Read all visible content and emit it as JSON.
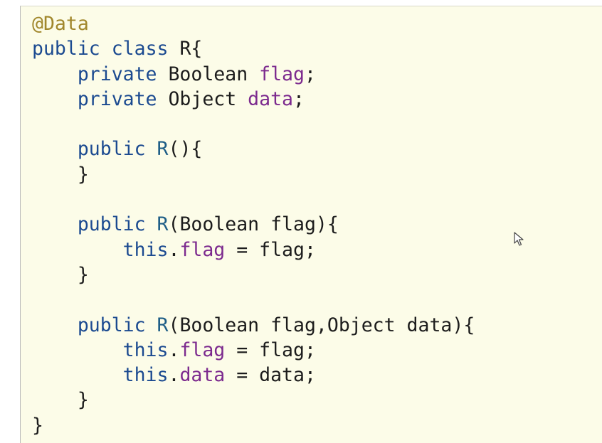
{
  "code": {
    "lines": [
      [
        {
          "text": "@Data",
          "kind": "annotation"
        }
      ],
      [
        {
          "text": "public",
          "kind": "keyword"
        },
        {
          "text": " ",
          "kind": "plain"
        },
        {
          "text": "class",
          "kind": "keyword"
        },
        {
          "text": " R{",
          "kind": "plain"
        }
      ],
      [
        {
          "text": "    ",
          "kind": "plain"
        },
        {
          "text": "private",
          "kind": "keyword"
        },
        {
          "text": " Boolean ",
          "kind": "plain"
        },
        {
          "text": "flag",
          "kind": "field"
        },
        {
          "text": ";",
          "kind": "plain"
        }
      ],
      [
        {
          "text": "    ",
          "kind": "plain"
        },
        {
          "text": "private",
          "kind": "keyword"
        },
        {
          "text": " Object ",
          "kind": "plain"
        },
        {
          "text": "data",
          "kind": "field"
        },
        {
          "text": ";",
          "kind": "plain"
        }
      ],
      [],
      [
        {
          "text": "    ",
          "kind": "plain"
        },
        {
          "text": "public",
          "kind": "keyword"
        },
        {
          "text": " ",
          "kind": "plain"
        },
        {
          "text": "R",
          "kind": "method"
        },
        {
          "text": "(){",
          "kind": "plain"
        }
      ],
      [
        {
          "text": "    }",
          "kind": "plain"
        }
      ],
      [],
      [
        {
          "text": "    ",
          "kind": "plain"
        },
        {
          "text": "public",
          "kind": "keyword"
        },
        {
          "text": " ",
          "kind": "plain"
        },
        {
          "text": "R",
          "kind": "method"
        },
        {
          "text": "(Boolean flag){",
          "kind": "plain"
        }
      ],
      [
        {
          "text": "        ",
          "kind": "plain"
        },
        {
          "text": "this",
          "kind": "keyword"
        },
        {
          "text": ".",
          "kind": "plain"
        },
        {
          "text": "flag",
          "kind": "field"
        },
        {
          "text": " = flag;",
          "kind": "plain"
        }
      ],
      [
        {
          "text": "    }",
          "kind": "plain"
        }
      ],
      [],
      [
        {
          "text": "    ",
          "kind": "plain"
        },
        {
          "text": "public",
          "kind": "keyword"
        },
        {
          "text": " ",
          "kind": "plain"
        },
        {
          "text": "R",
          "kind": "method"
        },
        {
          "text": "(Boolean flag,Object data){",
          "kind": "plain"
        }
      ],
      [
        {
          "text": "        ",
          "kind": "plain"
        },
        {
          "text": "this",
          "kind": "keyword"
        },
        {
          "text": ".",
          "kind": "plain"
        },
        {
          "text": "flag",
          "kind": "field"
        },
        {
          "text": " = flag;",
          "kind": "plain"
        }
      ],
      [
        {
          "text": "        ",
          "kind": "plain"
        },
        {
          "text": "this",
          "kind": "keyword"
        },
        {
          "text": ".",
          "kind": "plain"
        },
        {
          "text": "data",
          "kind": "field"
        },
        {
          "text": " = data;",
          "kind": "plain"
        }
      ],
      [
        {
          "text": "    }",
          "kind": "plain"
        }
      ],
      [
        {
          "text": "}",
          "kind": "plain"
        }
      ]
    ]
  },
  "colors": {
    "panel_background": "#fcfce8",
    "annotation": "#a1872c",
    "keyword": "#1b4a90",
    "field": "#7c2a8e",
    "method": "#1d5d86",
    "plain": "#1c1c1c"
  },
  "pointer": {
    "icon": "mouse-pointer-icon"
  }
}
